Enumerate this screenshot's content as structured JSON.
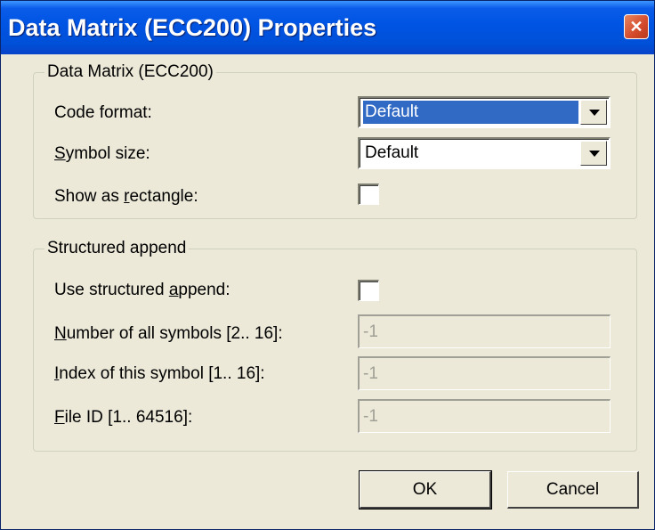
{
  "window": {
    "title": "Data Matrix (ECC200) Properties",
    "close_glyph": "✕"
  },
  "group1": {
    "legend": "Data Matrix (ECC200)",
    "code_format": {
      "label": "Code format:",
      "value": "Default"
    },
    "symbol_size": {
      "label_accel": "S",
      "label_rest": "ymbol size:",
      "value": "Default"
    },
    "rectangle": {
      "label_pre": "Show as ",
      "label_accel": "r",
      "label_post": "ectangle:",
      "checked": false
    }
  },
  "group2": {
    "legend": "Structured append",
    "use_append": {
      "label_pre": "Use structured ",
      "label_accel": "a",
      "label_post": "ppend:",
      "checked": false
    },
    "num_symbols": {
      "label_accel": "N",
      "label_rest": "umber of all symbols [2.. 16]:",
      "value": "-1"
    },
    "index": {
      "label_accel": "I",
      "label_rest": "ndex of this symbol [1.. 16]:",
      "value": "-1"
    },
    "file_id": {
      "label_accel": "F",
      "label_rest": "ile ID [1.. 64516]:",
      "value": "-1"
    }
  },
  "buttons": {
    "ok": "OK",
    "cancel": "Cancel"
  },
  "colors": {
    "titlebar": "#0054e3",
    "face": "#ece9d8",
    "selection": "#316ac5"
  }
}
